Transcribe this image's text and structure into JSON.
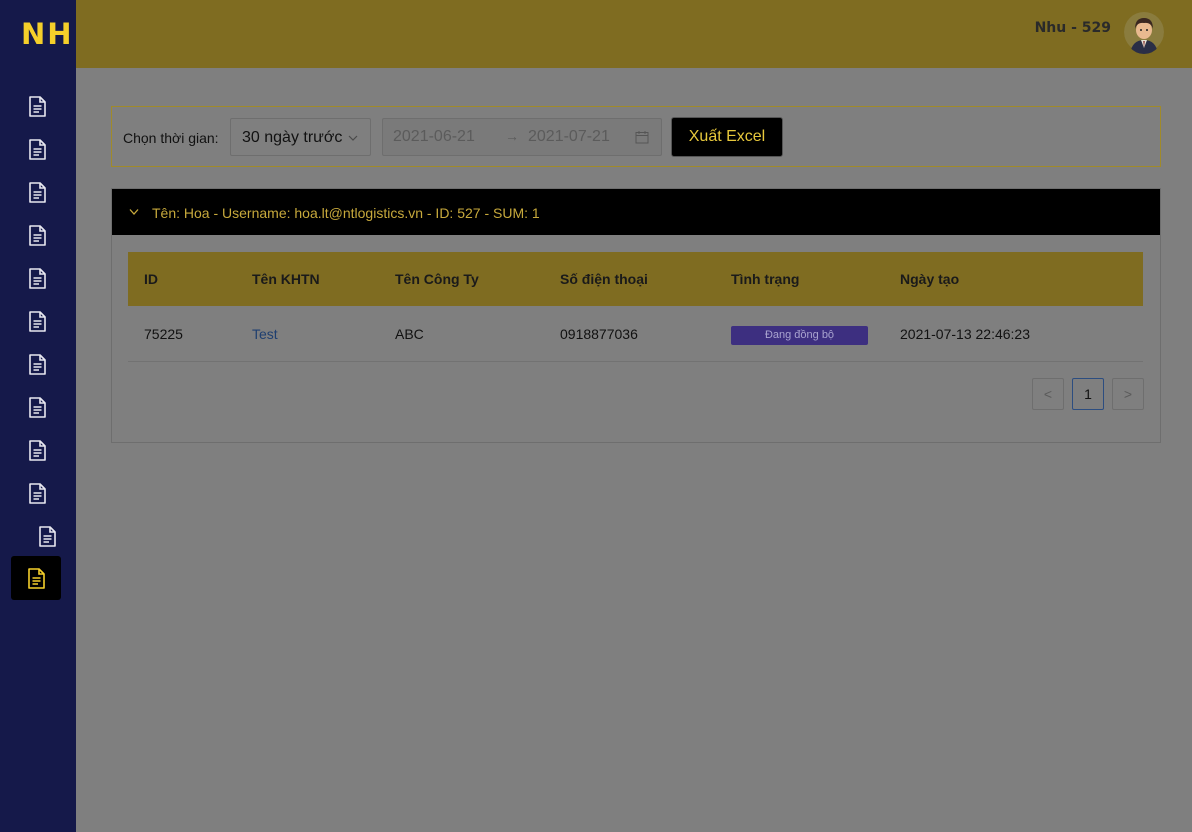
{
  "brand": {
    "logo_text": "NHF"
  },
  "colors": {
    "sidebar_bg": "#15194a",
    "accent": "#f5cf2a",
    "header_bg": "#7f6c21",
    "badge_bg": "#3d2f80"
  },
  "sidebar": {
    "items": [
      {
        "icon": "document-icon"
      },
      {
        "icon": "document-icon"
      },
      {
        "icon": "document-icon"
      },
      {
        "icon": "document-icon"
      },
      {
        "icon": "document-icon"
      },
      {
        "icon": "document-icon"
      },
      {
        "icon": "document-icon"
      },
      {
        "icon": "document-icon"
      },
      {
        "icon": "document-icon"
      },
      {
        "icon": "document-icon"
      },
      {
        "icon": "document-icon"
      },
      {
        "icon": "document-icon",
        "active": true
      }
    ]
  },
  "header": {
    "user_name": "Nhu - 529",
    "avatar_icon": "avatar-icon"
  },
  "filter": {
    "label": "Chọn thời gian:",
    "period_selected": "30 ngày trước",
    "date_start": "2021-06-21",
    "date_separator": "→",
    "date_end": "2021-07-21",
    "export_label": "Xuất Excel"
  },
  "panel": {
    "title": "Tên: Hoa - Username: hoa.lt@ntlogistics.vn - ID: 527 - SUM: 1",
    "expanded": true
  },
  "table": {
    "columns": [
      "ID",
      "Tên KHTN",
      "Tên Công Ty",
      "Số điện thoại",
      "Tình trạng",
      "Ngày tạo"
    ],
    "rows": [
      {
        "id": "75225",
        "name": "Test",
        "company": "ABC",
        "phone": "0918877036",
        "status": "Đang đồng bộ",
        "created": "2021-07-13 22:46:23"
      }
    ]
  },
  "pagination": {
    "prev": "<",
    "current": "1",
    "next": ">"
  }
}
